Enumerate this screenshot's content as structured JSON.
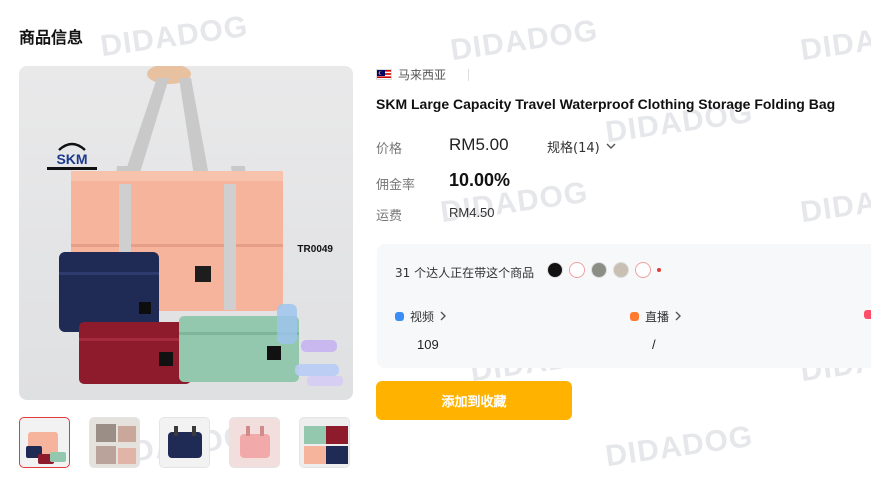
{
  "section_title": "商品信息",
  "watermark": "DIDADOG",
  "product": {
    "sku_code": "TR0049",
    "brand": "SKM",
    "country": "马来西亚",
    "title": "SKM Large Capacity Travel Waterproof Clothing Storage Folding Bag",
    "price_label": "价格",
    "price": "RM5.00",
    "spec_label": "规格(14)",
    "commission_label": "佣金率",
    "commission": "10.00%",
    "shipping_label": "运费",
    "shipping": "RM4.50"
  },
  "creators": {
    "count_text": "31 个达人正在带这个商品",
    "video_label": "视频",
    "video_value": "109",
    "live_label": "直播",
    "live_value": "/"
  },
  "add_button_label": "添加到收藏",
  "colors": {
    "accent": "#ffb300",
    "active_thumb_border": "#e63a3a",
    "video_dot": "#3a8ef6",
    "live_dot": "#ff7a2e"
  }
}
